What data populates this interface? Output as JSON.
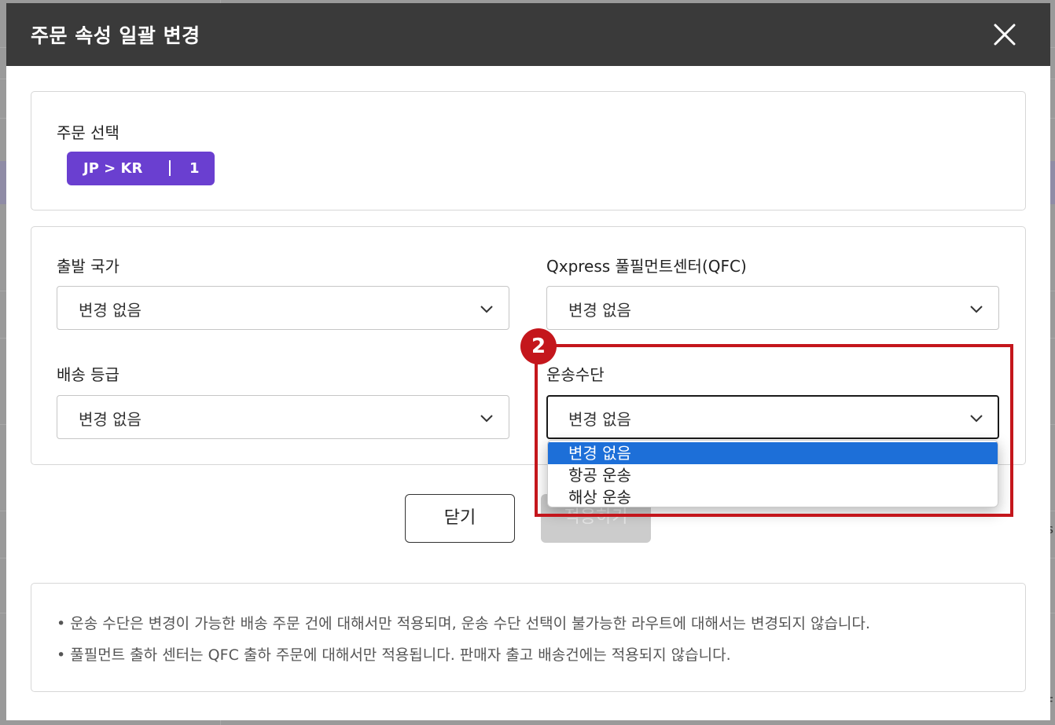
{
  "modal": {
    "title": "주문 속성 일괄 변경"
  },
  "order_selection": {
    "label": "주문 선택",
    "chip_route": "JP > KR",
    "chip_count": "1"
  },
  "fields": {
    "origin_country": {
      "label": "출발 국가",
      "value": "변경 없음"
    },
    "qfc": {
      "label": "Qxpress 풀필먼트센터(QFC)",
      "value": "변경 없음"
    },
    "shipping_grade": {
      "label": "배송 등급",
      "value": "변경 없음"
    },
    "transport": {
      "label": "운송수단",
      "value": "변경 없음"
    }
  },
  "transport_dropdown": {
    "options": [
      "변경 없음",
      "항공 운송",
      "해상 운송"
    ],
    "selected_index": 0
  },
  "annotation": {
    "step_number": "2",
    "color": "#c4161c"
  },
  "buttons": {
    "close_label": "닫기",
    "apply_label": "적용하기"
  },
  "notices": [
    "• 운송 수단은 변경이 가능한 배송 주문 건에 대해서만 적용되며, 운송 수단 선택이 불가능한 라우트에 대해서는 변경되지 않습니다.",
    "• 풀필먼트 출하 센터는 QFC 출하 주문에 대해서만 적용됩니다. 판매자 출고 배송건에는 적용되지 않습니다."
  ],
  "background": {
    "edge_chars": [
      "s",
      "F"
    ]
  },
  "colors": {
    "header_bg": "#3a3a3a",
    "chip_bg": "#6a3fd0",
    "selected_option_bg": "#1d6fd8",
    "annotation_red": "#c4161c"
  }
}
